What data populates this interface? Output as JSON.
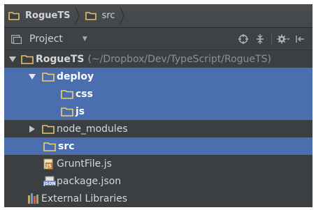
{
  "breadcrumb": {
    "items": [
      "RogueTS",
      "src"
    ]
  },
  "toolbar": {
    "view_label": "Project",
    "icons": [
      "target-icon",
      "collapse-icon",
      "gear-icon",
      "hide-icon"
    ]
  },
  "tree": {
    "root": {
      "name": "RogueTS",
      "path": "(~/Dropbox/Dev/TypeScript/RogueTS)"
    },
    "deploy": "deploy",
    "css": "css",
    "js": "js",
    "node_modules": "node_modules",
    "src": "src",
    "gruntfile": "GruntFile.js",
    "package_json": "package.json",
    "external_libraries": "External Libraries"
  },
  "colors": {
    "folder": "#e8c46a",
    "selection": "#4b6eaf",
    "background": "#3c3f41"
  }
}
